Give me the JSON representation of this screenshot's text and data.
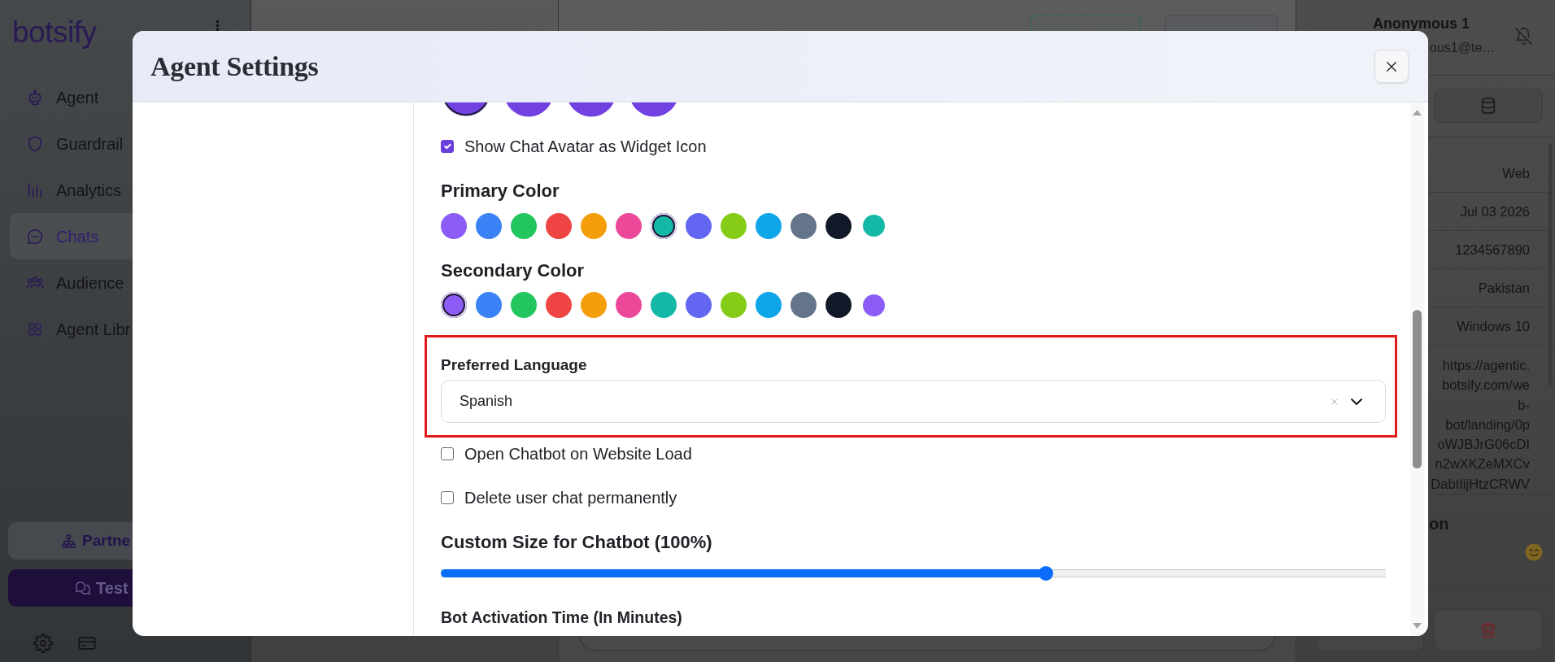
{
  "sidebar": {
    "logo": "botsify",
    "items": [
      {
        "label": "Agent",
        "selected": false
      },
      {
        "label": "Guardrail",
        "selected": false
      },
      {
        "label": "Analytics",
        "selected": false
      },
      {
        "label": "Chats",
        "selected": true
      },
      {
        "label": "Audience",
        "selected": false
      },
      {
        "label": "Agent Libr",
        "selected": false
      }
    ],
    "partner_button": "Partne",
    "test_button": "Test"
  },
  "contact": {
    "name": "Anonymous 1",
    "email": "ous1@te…",
    "details": [
      "Web",
      "Jul 03 2026",
      "1234567890",
      "Pakistan",
      "Windows 10"
    ],
    "url_lines": [
      "https://agentic.",
      "botsify.com/we",
      "b-",
      "bot/landing/0p",
      "oWJBJrG06cDI",
      "n2wXKZeMXCv",
      "DabtIijHtzCRWV"
    ],
    "section_title": "on"
  },
  "dialog": {
    "title": "Agent Settings",
    "settings": [
      {
        "kind": "avatars",
        "options": [
          {
            "selected": true
          },
          {
            "selected": false
          },
          {
            "selected": false
          },
          {
            "selected": false
          }
        ]
      },
      {
        "kind": "checkbox",
        "label": "Show Chat Avatar as Widget Icon",
        "checked": true
      },
      {
        "kind": "colors",
        "label": "Primary Color",
        "swatches": [
          {
            "kind": "preset",
            "color": "#8b5cf6",
            "selected": false
          },
          {
            "kind": "preset",
            "color": "#3b82f6",
            "selected": false
          },
          {
            "kind": "preset",
            "color": "#22c55e",
            "selected": false
          },
          {
            "kind": "preset",
            "color": "#ef4444",
            "selected": false
          },
          {
            "kind": "preset",
            "color": "#f59e0b",
            "selected": false
          },
          {
            "kind": "preset",
            "color": "#ec4899",
            "selected": false
          },
          {
            "kind": "preset",
            "color": "#14b8a6",
            "selected": true
          },
          {
            "kind": "preset",
            "color": "#6366f1",
            "selected": false
          },
          {
            "kind": "preset",
            "color": "#84cc16",
            "selected": false
          },
          {
            "kind": "preset",
            "color": "#0ea5e9",
            "selected": false
          },
          {
            "kind": "preset",
            "color": "#64748b",
            "selected": false
          },
          {
            "kind": "preset",
            "color": "#111827",
            "selected": false
          },
          {
            "kind": "picker",
            "color": "#14b8a6",
            "selected": false
          }
        ]
      },
      {
        "kind": "colors",
        "label": "Secondary Color",
        "swatches": [
          {
            "kind": "preset",
            "color": "#8b5cf6",
            "selected": true
          },
          {
            "kind": "preset",
            "color": "#3b82f6",
            "selected": false
          },
          {
            "kind": "preset",
            "color": "#22c55e",
            "selected": false
          },
          {
            "kind": "preset",
            "color": "#ef4444",
            "selected": false
          },
          {
            "kind": "preset",
            "color": "#f59e0b",
            "selected": false
          },
          {
            "kind": "preset",
            "color": "#ec4899",
            "selected": false
          },
          {
            "kind": "preset",
            "color": "#14b8a6",
            "selected": false
          },
          {
            "kind": "preset",
            "color": "#6366f1",
            "selected": false
          },
          {
            "kind": "preset",
            "color": "#84cc16",
            "selected": false
          },
          {
            "kind": "preset",
            "color": "#0ea5e9",
            "selected": false
          },
          {
            "kind": "preset",
            "color": "#64748b",
            "selected": false
          },
          {
            "kind": "preset",
            "color": "#111827",
            "selected": false
          },
          {
            "kind": "picker",
            "color": "#8b5cf6",
            "selected": false
          }
        ]
      },
      {
        "kind": "select",
        "label": "Preferred Language",
        "value": "Spanish",
        "highlighted": true
      },
      {
        "kind": "checkbox",
        "label": "Open Chatbot on Website Load",
        "checked": false
      },
      {
        "kind": "checkbox",
        "label": "Delete user chat permanently",
        "checked": false
      },
      {
        "kind": "slider",
        "label": "Custom Size for Chatbot (100%)",
        "level": 0.64
      },
      {
        "kind": "field_label",
        "label": "Bot Activation Time (In Minutes)"
      }
    ]
  }
}
